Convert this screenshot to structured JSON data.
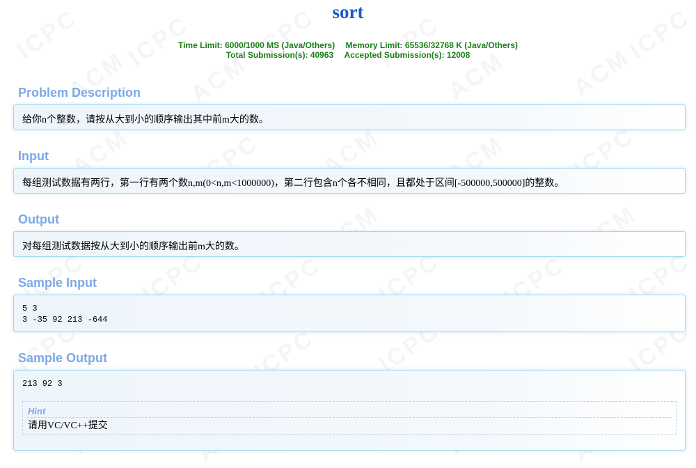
{
  "problem": {
    "title": "sort",
    "time_limit": "Time Limit: 6000/1000 MS (Java/Others)",
    "memory_limit": "Memory Limit: 65536/32768 K (Java/Others)",
    "total_submissions": "Total Submission(s): 40963",
    "accepted_submissions": "Accepted Submission(s): 12008"
  },
  "sections": {
    "description": {
      "heading": "Problem Description",
      "text": "给你n个整数，请按从大到小的顺序输出其中前m大的数。"
    },
    "input": {
      "heading": "Input",
      "text": "每组测试数据有两行，第一行有两个数n,m(0<n,m<1000000)，第二行包含n个各不相同，且都处于区间[-500000,500000]的整数。"
    },
    "output": {
      "heading": "Output",
      "text": "对每组测试数据按从大到小的顺序输出前m大的数。"
    },
    "sample_input": {
      "heading": "Sample Input",
      "line1": "5 3",
      "line2": "3 -35 92 213 -644"
    },
    "sample_output": {
      "heading": "Sample Output",
      "line1": "213 92 3",
      "hint_title": "Hint",
      "hint_text": "请用VC/VC++提交"
    }
  },
  "watermark": [
    "ACM",
    "ICPC"
  ]
}
